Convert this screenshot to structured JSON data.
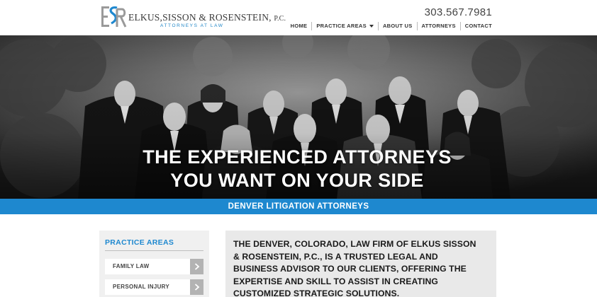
{
  "header": {
    "firm_name": "ELKUS,SISSON & ROSENSTEIN,",
    "firm_suffix": "P.C.",
    "tagline": "ATTORNEYS AT LAW",
    "phone": "303.567.7981"
  },
  "nav": {
    "items": [
      {
        "label": "HOME"
      },
      {
        "label": "PRACTICE AREAS"
      },
      {
        "label": "ABOUT US"
      },
      {
        "label": "ATTORNEYS"
      },
      {
        "label": "CONTACT"
      }
    ]
  },
  "hero": {
    "headline_line1": "THE EXPERIENCED ATTORNEYS",
    "headline_line2": "YOU WANT ON YOUR SIDE"
  },
  "banner": {
    "text": "DENVER LITIGATION ATTORNEYS"
  },
  "sidebar": {
    "title": "PRACTICE AREAS",
    "items": [
      {
        "label": "FAMILY LAW"
      },
      {
        "label": "PERSONAL INJURY"
      }
    ]
  },
  "main": {
    "intro": "THE DENVER, COLORADO, LAW FIRM OF ELKUS SISSON & ROSENSTEIN, P.C., IS A TRUSTED LEGAL AND BUSINESS ADVISOR TO OUR CLIENTS, OFFERING THE EXPERTISE AND SKILL TO ASSIST IN CREATING CUSTOMIZED STRATEGIC SOLUTIONS."
  },
  "colors": {
    "accent_blue": "#1e88cf",
    "logo_gray": "#9a9a9a",
    "arrow_gray": "#b3b3b3"
  },
  "icons": {
    "logo": "esr-monogram-icon",
    "nav_dropdown": "chevron-down-icon",
    "sidebar_arrow": "chevron-right-icon"
  }
}
